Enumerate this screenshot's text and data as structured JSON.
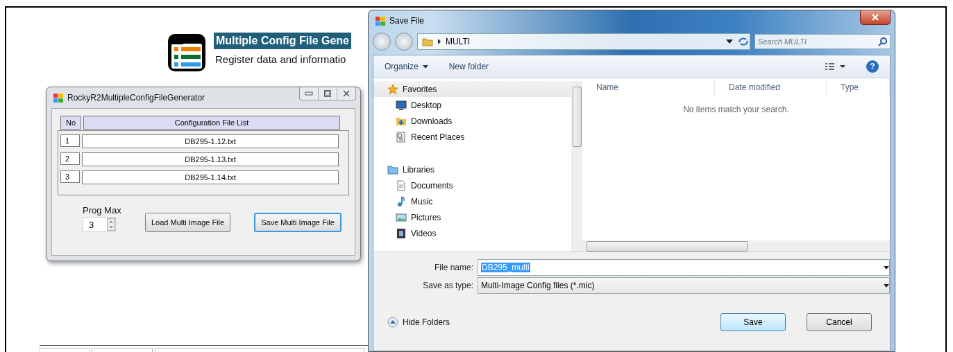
{
  "page_header": {
    "title": "Multiple Config File Gene",
    "subtitle": "Register data and informatio"
  },
  "app_window": {
    "title": "RockyR2MultipleConfigFileGenerator",
    "table": {
      "columns": [
        "No",
        "Configuration File List"
      ],
      "rows": [
        [
          "1",
          "DB295-1.12.txt"
        ],
        [
          "2",
          "DB295-1.13.txt"
        ],
        [
          "3",
          "DB295-1.14.txt"
        ]
      ]
    },
    "prog_max": {
      "label": "Prog Max",
      "value": "3"
    },
    "buttons": [
      {
        "label": "Load Multi Image File",
        "focused": false
      },
      {
        "label": "Save Multi Image File",
        "focused": true
      }
    ]
  },
  "save_dialog": {
    "title": "Save File",
    "breadcrumb": "MULTI",
    "search": {
      "placeholder": "Search MULTI"
    },
    "toolbar": [
      {
        "label": "Organize",
        "dropdown": true
      },
      {
        "label": "New folder",
        "dropdown": false
      }
    ],
    "help": "?",
    "nav": [
      {
        "label": "Favorites",
        "kind": "star",
        "selected": true,
        "children": [
          {
            "label": "Desktop",
            "kind": "desktop",
            "selected": false
          },
          {
            "label": "Downloads",
            "kind": "downloads",
            "selected": false
          },
          {
            "label": "Recent Places",
            "kind": "recent",
            "selected": false
          }
        ]
      },
      {
        "label": "Libraries",
        "kind": "library",
        "selected": false,
        "children": [
          {
            "label": "Documents",
            "kind": "documents",
            "selected": false
          },
          {
            "label": "Music",
            "kind": "music",
            "selected": false
          },
          {
            "label": "Pictures",
            "kind": "pictures",
            "selected": false
          },
          {
            "label": "Videos",
            "kind": "videos",
            "selected": false
          }
        ]
      }
    ],
    "columns": [
      "Name",
      "Date modified",
      "Type"
    ],
    "empty_message": "No items match your search.",
    "file_name": {
      "label": "File name:",
      "value": "DB295_multi"
    },
    "save_as_type": {
      "label": "Save as type:",
      "value": "Multi-Image Config files (*.mic)"
    },
    "hide_folders": "Hide Folders",
    "buttons": [
      {
        "label": "Save",
        "default": true
      },
      {
        "label": "Cancel",
        "default": false
      }
    ]
  }
}
